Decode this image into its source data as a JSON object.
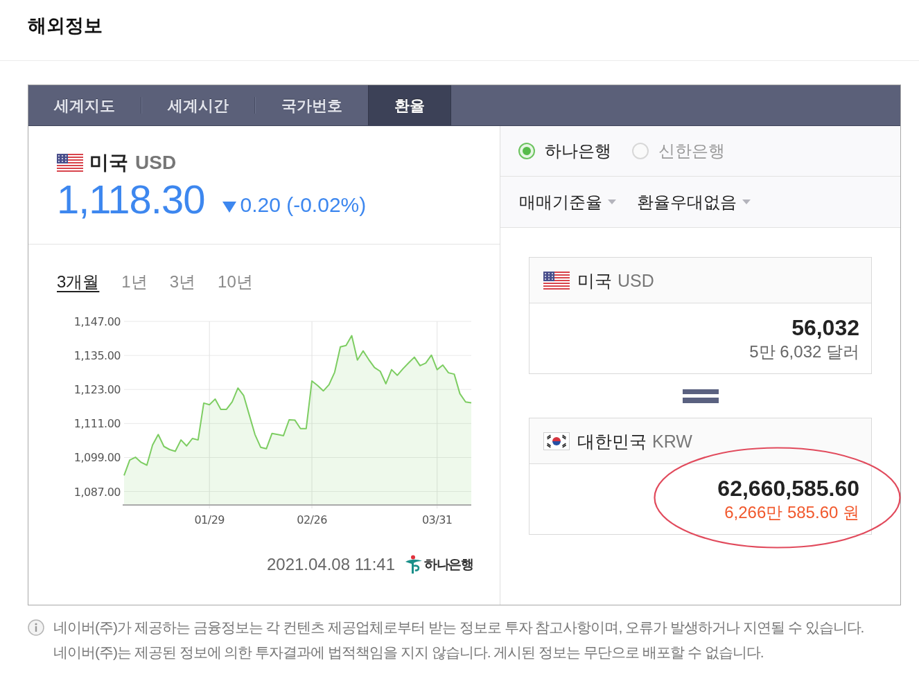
{
  "page_title": "해외정보",
  "tabs": [
    {
      "label": "세계지도",
      "selected": false
    },
    {
      "label": "세계시간",
      "selected": false
    },
    {
      "label": "국가번호",
      "selected": false
    },
    {
      "label": "환율",
      "selected": true
    }
  ],
  "quote": {
    "country": "미국",
    "currency": "USD",
    "price": "1,118.30",
    "falling": true,
    "change": "0.20 (-0.02%)"
  },
  "chart": {
    "periods": [
      {
        "label": "3개월",
        "selected": true
      },
      {
        "label": "1년",
        "selected": false
      },
      {
        "label": "3년",
        "selected": false
      },
      {
        "label": "10년",
        "selected": false
      }
    ],
    "chart_data": {
      "type": "area",
      "categories": [
        null,
        null,
        null,
        null,
        null,
        null,
        null,
        null,
        null,
        null,
        null,
        null,
        null,
        null,
        null,
        "01/29",
        null,
        null,
        null,
        null,
        null,
        null,
        null,
        null,
        null,
        null,
        null,
        null,
        null,
        null,
        null,
        null,
        null,
        "02/26",
        null,
        null,
        null,
        null,
        null,
        null,
        null,
        null,
        null,
        null,
        null,
        null,
        null,
        null,
        null,
        null,
        null,
        null,
        null,
        null,
        null,
        "03/31",
        null,
        null,
        null,
        null,
        null,
        null
      ],
      "values": [
        1092.7,
        1098.1,
        1099.1,
        1097.3,
        1096.3,
        1103.4,
        1107.1,
        1102.9,
        1101.8,
        1101.2,
        1105.2,
        1103.1,
        1105.7,
        1105.2,
        1118.2,
        1117.6,
        1119.6,
        1116.0,
        1116.0,
        1118.6,
        1123.5,
        1120.9,
        1114.0,
        1107.1,
        1102.6,
        1102.1,
        1107.5,
        1107.1,
        1106.7,
        1112.3,
        1112.2,
        1109.2,
        1109.2,
        1126.0,
        1124.4,
        1122.5,
        1124.7,
        1129.1,
        1138.0,
        1138.5,
        1142.0,
        1133.4,
        1136.6,
        1133.5,
        1130.7,
        1129.4,
        1125.0,
        1130.0,
        1128.0,
        1130.3,
        1132.4,
        1134.4,
        1131.4,
        1132.3,
        1135.1,
        1130.0,
        1131.6,
        1128.9,
        1128.4,
        1121.5,
        1118.6,
        1118.3
      ],
      "color": "#7dcd62",
      "ylim": [
        1082.5,
        1147
      ],
      "yticks": [
        {
          "value": 1087,
          "label": "1,087.00"
        },
        {
          "value": 1099,
          "label": "1,099.00"
        },
        {
          "value": 1111,
          "label": "1,111.00"
        },
        {
          "value": 1123,
          "label": "1,123.00"
        },
        {
          "value": 1135,
          "label": "1,135.00"
        },
        {
          "value": 1147,
          "label": "1,147.00"
        }
      ],
      "grid": true
    },
    "updated": "2021.04.08 11:41",
    "source": "하나은행"
  },
  "banks": [
    {
      "label": "하나은행",
      "selected": true
    },
    {
      "label": "신한은행",
      "selected": false
    }
  ],
  "dropdowns": [
    {
      "value": "매매기준율"
    },
    {
      "value": "환율우대없음"
    }
  ],
  "converter": {
    "from": {
      "country": "미국",
      "currency": "USD",
      "amount": "56,032",
      "amount_words": "5만 6,032 달러",
      "circled": false
    },
    "to": {
      "country": "대한민국",
      "currency": "KRW",
      "amount": "62,660,585.60",
      "amount_words": "6,266만 585.60 원",
      "circled": true
    }
  },
  "notice": [
    "네이버(주)가 제공하는 금융정보는 각 컨텐츠 제공업체로부터 받는 정보로 투자 참고사항이며, 오류가 발생하거나 지연될 수 있습니다.",
    "네이버(주)는 제공된 정보에 의한 투자결과에 법적책임을 지지 않습니다. 게시된 정보는 무단으로 배포할 수 없습니다."
  ]
}
